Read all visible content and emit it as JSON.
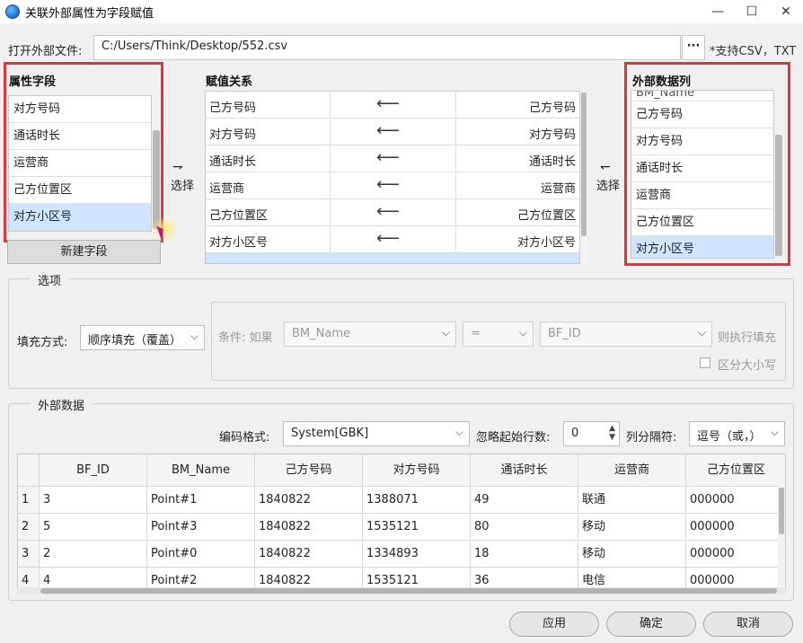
{
  "window": {
    "title": "关联外部属性为字段赋值",
    "minimize_glyph": "—",
    "maximize_glyph": "☐",
    "close_glyph": "✕"
  },
  "file": {
    "label": "打开外部文件:",
    "path": "C:/Users/Think/Desktop/552.csv",
    "browse_label": "···",
    "hint": "*支持CSV，TXT"
  },
  "attr_fields": {
    "label": "属性字段",
    "items": [
      {
        "label": "对方号码",
        "selected": false
      },
      {
        "label": "通话时长",
        "selected": false
      },
      {
        "label": "运营商",
        "selected": false
      },
      {
        "label": "己方位置区",
        "selected": false
      },
      {
        "label": "对方小区号",
        "selected": true
      }
    ],
    "new_field_button": "新建字段"
  },
  "select_left": {
    "label": "选择",
    "arrow": "⇁"
  },
  "select_right": {
    "label": "选择",
    "arrow": "↽"
  },
  "mapping": {
    "label": "赋值关系",
    "rows": [
      {
        "left": "己方号码",
        "arrow": "⟵",
        "right": "己方号码"
      },
      {
        "left": "对方号码",
        "arrow": "⟵",
        "right": "对方号码"
      },
      {
        "left": "通话时长",
        "arrow": "⟵",
        "right": "通话时长"
      },
      {
        "left": "运营商",
        "arrow": "⟵",
        "right": "运营商"
      },
      {
        "left": "己方位置区",
        "arrow": "⟵",
        "right": "己方位置区"
      },
      {
        "left": "对方小区号",
        "arrow": "⟵",
        "right": "对方小区号"
      }
    ]
  },
  "ext_columns": {
    "label": "外部数据列",
    "partial_top": "BM_Name",
    "items": [
      {
        "label": "己方号码",
        "selected": false
      },
      {
        "label": "对方号码",
        "selected": false
      },
      {
        "label": "通话时长",
        "selected": false
      },
      {
        "label": "运营商",
        "selected": false
      },
      {
        "label": "己方位置区",
        "selected": false
      },
      {
        "label": "对方小区号",
        "selected": true
      }
    ]
  },
  "options": {
    "title": "选项",
    "fill_mode_label": "填充方式:",
    "fill_mode_value": "顺序填充（覆盖）",
    "condition_label": "条件: 如果",
    "condition_field": "BM_Name",
    "condition_op": "=",
    "condition_value": "BF_ID",
    "then_label": "则执行填充",
    "case_sensitive_label": "区分大小写"
  },
  "external_data": {
    "title": "外部数据",
    "encoding_label": "编码格式:",
    "encoding_value": "System[GBK]",
    "skip_rows_label": "忽略起始行数:",
    "skip_rows_value": "0",
    "separator_label": "列分隔符:",
    "separator_value": "逗号（或，）",
    "columns": [
      "BF_ID",
      "BM_Name",
      "己方号码",
      "对方号码",
      "通话时长",
      "运营商",
      "己方位置区"
    ],
    "rows": [
      {
        "num": "1",
        "cells": [
          "3",
          "Point#1",
          "1840822",
          "1388071",
          "49",
          "联通",
          "000000"
        ]
      },
      {
        "num": "2",
        "cells": [
          "5",
          "Point#3",
          "1840822",
          "1535121",
          "80",
          "移动",
          "000000"
        ]
      },
      {
        "num": "3",
        "cells": [
          "2",
          "Point#0",
          "1840822",
          "1334893",
          "18",
          "移动",
          "000000"
        ]
      },
      {
        "num": "4",
        "cells": [
          "4",
          "Point#2",
          "1840822",
          "1535121",
          "36",
          "电信",
          "000000"
        ]
      }
    ]
  },
  "buttons": {
    "apply": "应用",
    "ok": "确定",
    "cancel": "取消"
  },
  "icons": {
    "app": "app-globe-icon",
    "dropdown": "chevron-down-icon"
  }
}
